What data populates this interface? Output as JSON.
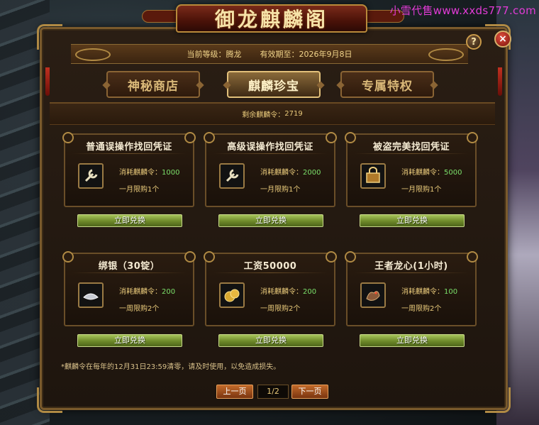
{
  "watermark": "小雪代售www.xxds777.com",
  "window": {
    "title": "御龙麒麟阁",
    "help": "?",
    "close": "×"
  },
  "info": {
    "level_label": "当前等级：",
    "level_value": "腾龙",
    "expire_label": "有效期至：",
    "expire_value": "2026年9月8日"
  },
  "tabs": [
    {
      "label": "神秘商店",
      "active": false
    },
    {
      "label": "麒麟珍宝",
      "active": true
    },
    {
      "label": "专属特权",
      "active": false
    }
  ],
  "remaining": {
    "label": "剩余麒麟令：",
    "value": "2719"
  },
  "cost_label": "消耗麒麟令：",
  "items": [
    {
      "title": "普通误操作找回凭证",
      "icon": "wrench-icon",
      "cost": "1000",
      "limit": "一月限购1个",
      "button": "立即兑换"
    },
    {
      "title": "高级误操作找回凭证",
      "icon": "wrench-icon",
      "cost": "2000",
      "limit": "一月限购1个",
      "button": "立即兑换"
    },
    {
      "title": "被盗完美找回凭证",
      "icon": "chest-icon",
      "cost": "5000",
      "limit": "一月限购1个",
      "button": "立即兑换"
    },
    {
      "title": "绑银（30锭）",
      "icon": "silver-ingot-icon",
      "cost": "200",
      "limit": "一周限购2个",
      "button": "立即兑换"
    },
    {
      "title": "工资50000",
      "icon": "gold-coins-icon",
      "cost": "200",
      "limit": "一周限购2个",
      "button": "立即兑换"
    },
    {
      "title": "王者龙心(1小时)",
      "icon": "dragon-heart-icon",
      "cost": "100",
      "limit": "一周限购2个",
      "button": "立即兑换"
    }
  ],
  "notice": "*麒麟令在每年的12月31日23:59清零，请及时使用，以免造成损失。",
  "pager": {
    "prev": "上一页",
    "page": "1/2",
    "next": "下一页"
  },
  "colors": {
    "accent_gold": "#e8c97a",
    "cost_green": "#7be06a",
    "button_green": "#6e8a2a"
  }
}
